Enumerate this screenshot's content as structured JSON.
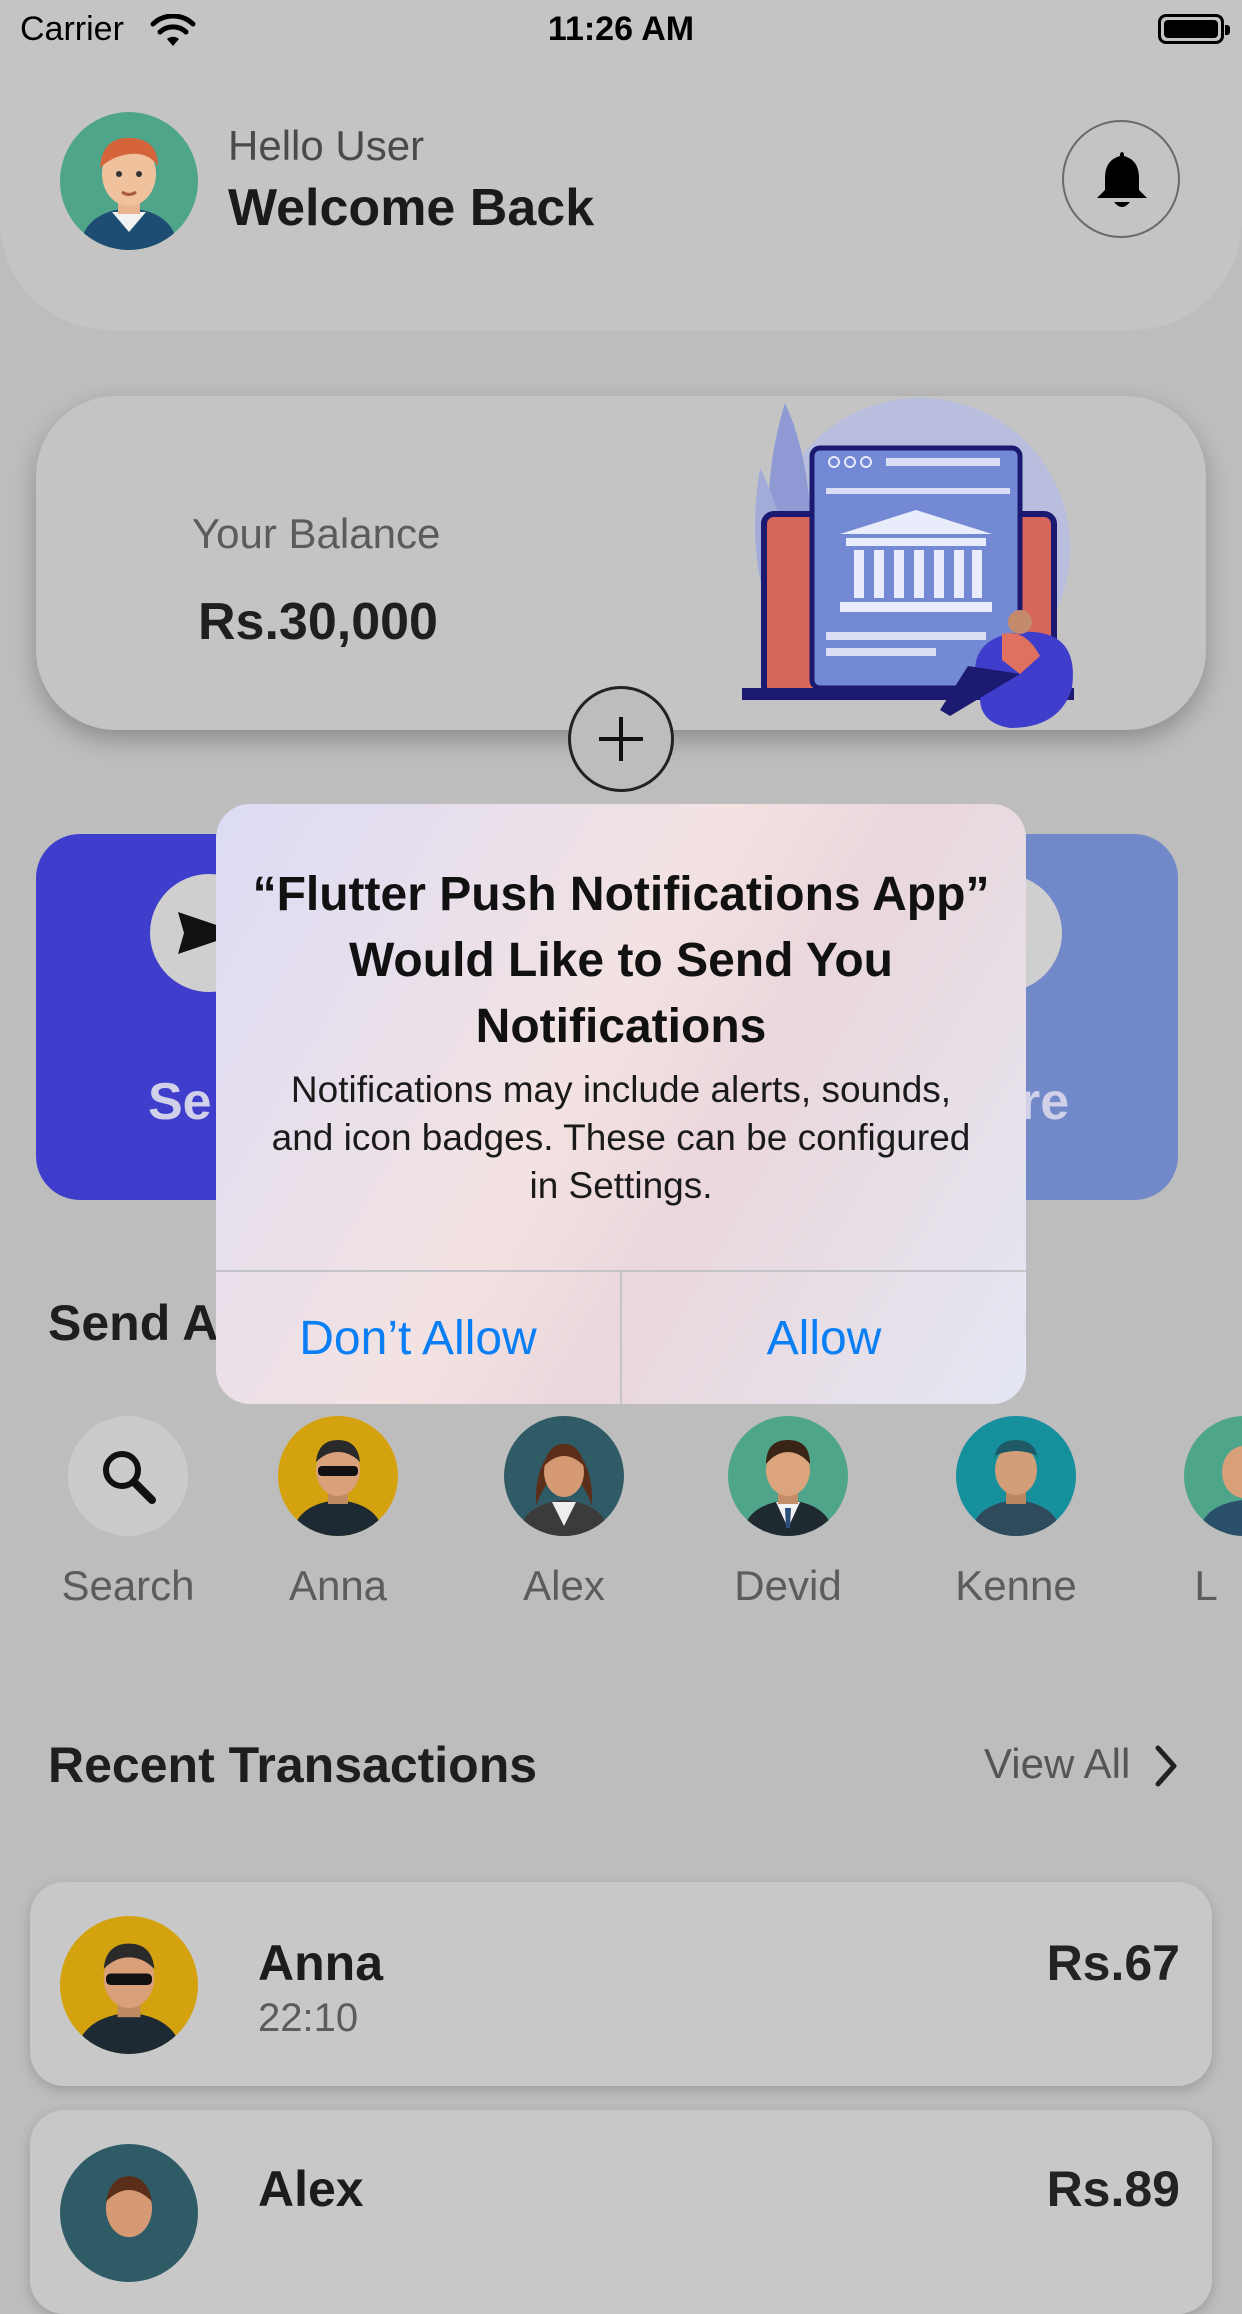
{
  "status_bar": {
    "carrier": "Carrier",
    "time": "11:26 AM",
    "wifi_icon": "wifi-icon",
    "battery_icon": "battery-icon"
  },
  "header": {
    "greeting": "Hello User",
    "welcome": "Welcome Back",
    "bell_icon": "bell-icon"
  },
  "balance": {
    "label": "Your Balance",
    "value": "Rs.30,000",
    "add_icon": "plus-icon"
  },
  "actions": {
    "send_label": "Se",
    "receive_label": "re",
    "send_icon": "send-icon",
    "receive_icon": "receive-icon"
  },
  "send_again": {
    "title": "Send A"
  },
  "contacts": [
    {
      "name": "Search"
    },
    {
      "name": "Anna"
    },
    {
      "name": "Alex"
    },
    {
      "name": "Devid"
    },
    {
      "name": "Kenne"
    },
    {
      "name": "L"
    }
  ],
  "recent": {
    "title": "Recent Transactions",
    "view_all": "View All"
  },
  "transactions": [
    {
      "name": "Anna",
      "time": "22:10",
      "amount": "Rs.67"
    },
    {
      "name": "Alex",
      "time": "",
      "amount": "Rs.89"
    }
  ],
  "alert": {
    "title": "“Flutter Push Notifications App” Would Like to Send You Notifications",
    "message": "Notifications may include alerts, sounds, and icon badges. These can be configured in Settings.",
    "deny_label": "Don’t Allow",
    "allow_label": "Allow"
  },
  "colors": {
    "send_card": "#3f3dcc",
    "receive_card": "#7188c9",
    "alert_button": "#0a7ff5"
  }
}
